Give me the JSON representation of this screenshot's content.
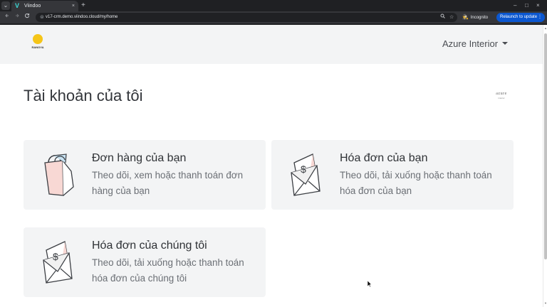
{
  "browser": {
    "tab_title": "Viindoo",
    "tab_close": "×",
    "new_tab": "+",
    "url": "v17-crm.demo.viindoo.cloud/my/home",
    "incognito_label": "Incognito",
    "relaunch_label": "Relaunch to update",
    "relaunch_menu": "⋮",
    "window_controls": [
      "–",
      "□",
      "×"
    ],
    "nav_icons": [
      "arrow-left-icon",
      "arrow-right-icon",
      "reload-icon"
    ]
  },
  "header": {
    "logo_text": "RANGYA",
    "account_name": "Azure Interior"
  },
  "page": {
    "title": "Tài khoản của tôi",
    "brand_mini_main": "azure",
    "brand_mini_sub": "interior"
  },
  "cards": [
    {
      "title": "Đơn hàng của bạn",
      "desc": "Theo dõi, xem hoặc thanh toán đơn hàng của bạn",
      "icon": "shopping-bag-icon"
    },
    {
      "title": "Hóa đơn của bạn",
      "desc": "Theo dõi, tải xuống hoặc thanh toán hóa đơn của bạn",
      "icon": "invoice-envelope-icon"
    },
    {
      "title": "Hóa đơn của chúng tôi",
      "desc": "Theo dõi, tải xuống hoặc thanh toán hóa đơn của chúng tôi",
      "icon": "invoice-envelope-icon"
    }
  ],
  "colors": {
    "accent": "#f5c518",
    "relaunch": "#0b57d0",
    "card_bg": "#f3f4f5"
  }
}
